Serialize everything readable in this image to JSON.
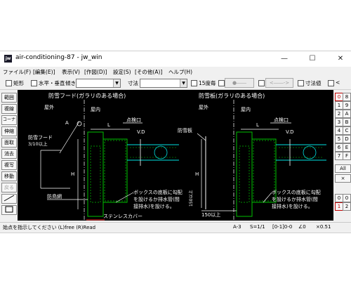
{
  "window": {
    "title": "air-conditioning-87 - jw_win",
    "icon_label": "jw",
    "controls": {
      "minimize": "—",
      "maximize": "☐",
      "close": "✕"
    }
  },
  "menu": [
    "ファイル(F)",
    "[編集(E)]",
    "表示(V)",
    "[作図(D)]",
    "設定(S)",
    "[その他(A)]",
    "ヘルプ(H)"
  ],
  "toolbar": {
    "rect_label": "矩形",
    "hv_label": "水平・垂直",
    "tilt_label": "傾き",
    "dim_label": "寸法",
    "deg15_label": "15度毎",
    "dis_btn1": "●――",
    "dis_btn2": "<――->",
    "dimval_label": "寸法値",
    "lt_label": "<"
  },
  "left_tools": [
    "範囲",
    "複線",
    "コーナー",
    "伸縮",
    "面取",
    "消去",
    "複写",
    "移動",
    "戻る"
  ],
  "right_tools": {
    "row1": [
      "0",
      "8"
    ],
    "row2": [
      "1",
      "9"
    ],
    "row3": [
      "2",
      "A"
    ],
    "row4": [
      "3",
      "B"
    ],
    "row5": [
      "4",
      "C"
    ],
    "row6": [
      "5",
      "D"
    ],
    "row7": [
      "6",
      "E"
    ],
    "row8": [
      "7",
      "F"
    ],
    "all_label": "All",
    "x_label": "×",
    "bottom_row1": [
      "0",
      "0"
    ],
    "bottom_row2": [
      "1",
      "2"
    ]
  },
  "drawing": {
    "left": {
      "title": "防雪フード(ガラリのある場合)",
      "outdoor": "屋外",
      "indoor": "屋内",
      "A": "A",
      "L": "L",
      "inspection": "点検口",
      "vd": "V.D",
      "hood_label": "防雪フード",
      "hood_ratio": "3/10以上",
      "H": "H",
      "mesh": "防鳥網",
      "note1": "ボックスの底板に勾配",
      "note2": "を設けるか排水管(間",
      "note3": "接排水)を設ける。",
      "stainless": "ステンレスカバー"
    },
    "right": {
      "title": "防雪板(ガラリのある場合)",
      "outdoor": "屋外",
      "indoor": "屋内",
      "L": "L",
      "inspection": "点検口",
      "vd": "V.D",
      "plate_label": "防雪板",
      "H": "H",
      "dim150a": "150以上",
      "dim150b": "150以上",
      "note1": "ボックスの底板に勾配",
      "note2": "を設けるか排水管(間",
      "note3": "接排水)を設ける。"
    }
  },
  "status": {
    "message": "始点を指示してください (L)free (R)Read",
    "layer": "A-3",
    "scale": "S=1/1",
    "group": "[0-1]0-0",
    "angle": "∠0",
    "zoom": "×0.51"
  },
  "colors": {
    "canvas_bg": "#000000",
    "wall_green": "#00c000",
    "cyan": "#00e0e0",
    "line_white": "#ffffff",
    "accent_red": "#c00000"
  }
}
